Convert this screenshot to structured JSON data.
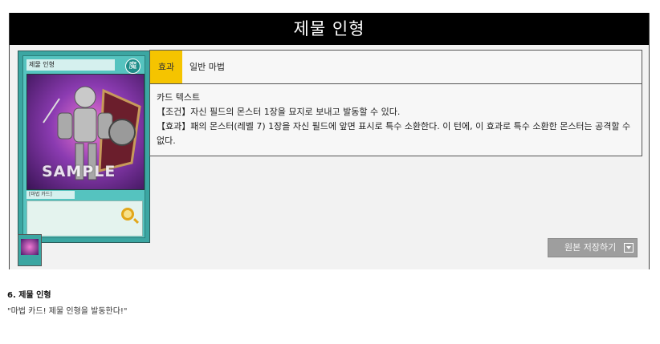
{
  "title": "제물 인형",
  "card": {
    "name": "제물 인형",
    "attribute_mark": "魔",
    "watermark": "SAMPLE",
    "subtitle": "[마법 카드]"
  },
  "info": {
    "tag": "효과",
    "type": "일반 마법",
    "text_heading": "카드 텍스트",
    "condition": "【조건】자신 필드의 몬스터 1장을 묘지로 보내고 발동할 수 있다.",
    "effect": "【효과】패의 몬스터(레벨 7) 1장을 자신 필드에 앞면 표시로 특수 소환한다. 이 턴에, 이 효과로 특수 소환한 몬스터는 공격할 수 없다."
  },
  "save_button": {
    "label": "원본 저장하기"
  },
  "caption": {
    "title": "6. 제물 인형",
    "quote": "\"마법 카드! 제물 인형을 발동한다!\""
  },
  "icons": {
    "save": "download-icon",
    "card_zoom": "magnifier-icon"
  },
  "colors": {
    "title_bar": "#000000",
    "tag_bg": "#f5c400",
    "button_bg": "#9e9e9e",
    "card_frame": "#3ba6a2"
  }
}
